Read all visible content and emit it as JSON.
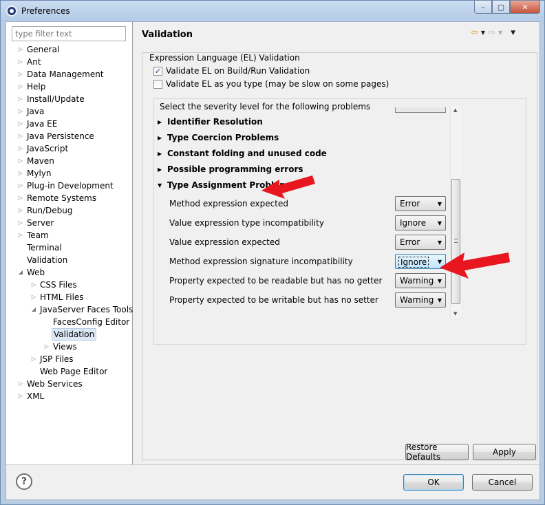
{
  "window": {
    "title": "Preferences",
    "min_glyph": "–",
    "max_glyph": "▢",
    "close_glyph": "✕"
  },
  "filter": {
    "placeholder": "type filter text"
  },
  "tree": [
    {
      "label": "General",
      "depth": 0,
      "arrow": "▷"
    },
    {
      "label": "Ant",
      "depth": 0,
      "arrow": "▷"
    },
    {
      "label": "Data Management",
      "depth": 0,
      "arrow": "▷"
    },
    {
      "label": "Help",
      "depth": 0,
      "arrow": "▷"
    },
    {
      "label": "Install/Update",
      "depth": 0,
      "arrow": "▷"
    },
    {
      "label": "Java",
      "depth": 0,
      "arrow": "▷"
    },
    {
      "label": "Java EE",
      "depth": 0,
      "arrow": "▷"
    },
    {
      "label": "Java Persistence",
      "depth": 0,
      "arrow": "▷"
    },
    {
      "label": "JavaScript",
      "depth": 0,
      "arrow": "▷"
    },
    {
      "label": "Maven",
      "depth": 0,
      "arrow": "▷"
    },
    {
      "label": "Mylyn",
      "depth": 0,
      "arrow": "▷"
    },
    {
      "label": "Plug-in Development",
      "depth": 0,
      "arrow": "▷"
    },
    {
      "label": "Remote Systems",
      "depth": 0,
      "arrow": "▷"
    },
    {
      "label": "Run/Debug",
      "depth": 0,
      "arrow": "▷"
    },
    {
      "label": "Server",
      "depth": 0,
      "arrow": "▷"
    },
    {
      "label": "Team",
      "depth": 0,
      "arrow": "▷"
    },
    {
      "label": "Terminal",
      "depth": 0,
      "arrow": ""
    },
    {
      "label": "Validation",
      "depth": 0,
      "arrow": ""
    },
    {
      "label": "Web",
      "depth": 0,
      "arrow": "◢"
    },
    {
      "label": "CSS Files",
      "depth": 1,
      "arrow": "▷"
    },
    {
      "label": "HTML Files",
      "depth": 1,
      "arrow": "▷"
    },
    {
      "label": "JavaServer Faces Tools",
      "depth": 1,
      "arrow": "◢"
    },
    {
      "label": "FacesConfig Editor",
      "depth": 2,
      "arrow": ""
    },
    {
      "label": "Validation",
      "depth": 2,
      "arrow": "",
      "selected": true
    },
    {
      "label": "Views",
      "depth": 2,
      "arrow": "▷"
    },
    {
      "label": "JSP Files",
      "depth": 1,
      "arrow": "▷"
    },
    {
      "label": "Web Page Editor",
      "depth": 1,
      "arrow": ""
    },
    {
      "label": "Web Services",
      "depth": 0,
      "arrow": "▷"
    },
    {
      "label": "XML",
      "depth": 0,
      "arrow": "▷"
    }
  ],
  "page": {
    "title": "Validation",
    "group_label": "Expression Language (EL) Validation",
    "check1": {
      "label": "Validate EL on Build/Run Validation",
      "checked": true
    },
    "check2": {
      "label": "Validate EL as you type (may be slow on some pages)",
      "checked": false
    },
    "severity_label": "Select the severity level for the following problems"
  },
  "sections": [
    {
      "label": "Identifier Resolution",
      "expanded": false
    },
    {
      "label": "Type Coercion Problems",
      "expanded": false
    },
    {
      "label": "Constant folding and unused code",
      "expanded": false
    },
    {
      "label": "Possible programming errors",
      "expanded": false
    },
    {
      "label": "Type Assignment Problems",
      "expanded": true
    }
  ],
  "problems": [
    {
      "label": "Method expression expected",
      "value": "Error"
    },
    {
      "label": "Value expression type incompatibility",
      "value": "Ignore"
    },
    {
      "label": "Value expression expected",
      "value": "Error"
    },
    {
      "label": "Method expression signature incompatibility",
      "value": "Ignore",
      "focused": true
    },
    {
      "label": "Property expected to be readable but has no getter",
      "value": "Warning"
    },
    {
      "label": "Property expected to be writable but has no setter",
      "value": "Warning"
    }
  ],
  "buttons": {
    "restore": "Restore Defaults",
    "apply": "Apply",
    "ok": "OK",
    "cancel": "Cancel",
    "help": "?"
  },
  "icons": {
    "window": "eclipse-icon",
    "back": "back-arrow-icon",
    "forward": "forward-arrow-icon",
    "menu": "view-menu-icon"
  },
  "colors": {
    "title_bar": "#b8cde4",
    "annotation_arrow": "#e8171f",
    "selection": "#dde8f5"
  }
}
